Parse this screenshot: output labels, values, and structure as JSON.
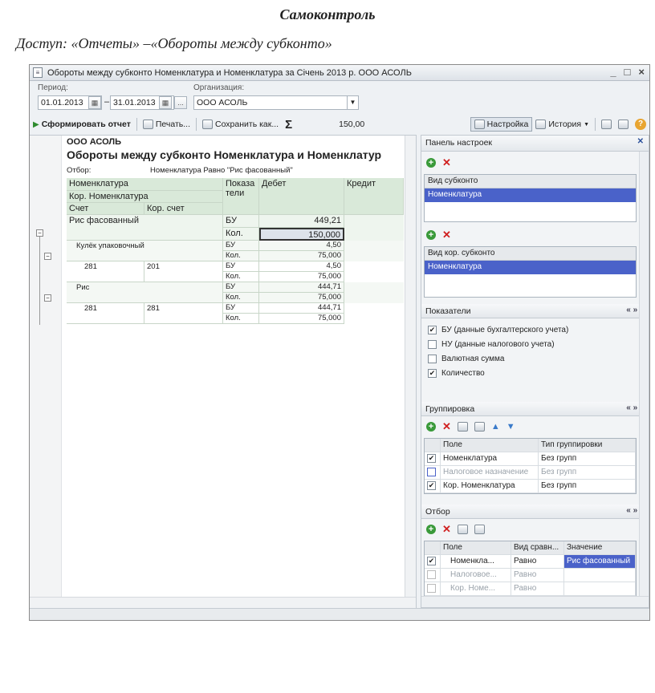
{
  "page": {
    "heading": "Самоконтроль",
    "subheading": "Доступ: «Отчеты» –«Обороты между субконто»"
  },
  "window": {
    "title": "Обороты между субконто Номенклатура и Номенклатура за Січень 2013 р. ООО АСОЛЬ",
    "controls": [
      "_",
      "□",
      "×"
    ]
  },
  "filters": {
    "period_label": "Период:",
    "date_from": "01.01.2013",
    "dash": "–",
    "date_to": "31.01.2013",
    "ellipsis": "...",
    "org_label": "Организация:",
    "org_value": "ООО АСОЛЬ"
  },
  "toolbar": {
    "generate": "Сформировать отчет",
    "print": "Печать...",
    "save": "Сохранить как...",
    "sigma": "Σ",
    "sum": "150,00",
    "settings": "Настройка",
    "history": "История",
    "help": "?"
  },
  "report": {
    "org": "ООО АСОЛЬ",
    "title": "Обороты между субконто Номенклатура и Номенклатур",
    "filter_label": "Отбор:",
    "filter_text": "Номенклатура Равно \"Рис фасованный\"",
    "headers": {
      "nom": "Номенклатура",
      "pokaz": "Показа тели",
      "debet": "Дебет",
      "kredit": "Кредит",
      "kor_nom": "Кор. Номенклатура",
      "schet": "Счет",
      "kor_schet": "Кор. счет"
    },
    "rows": [
      {
        "name": "Рис фасованный",
        "bu": "БУ",
        "bu_val": "449,21",
        "kol": "Кол.",
        "kol_val": "150,000"
      },
      {
        "name": "Кулёк упаковочный",
        "bu": "БУ",
        "bu_val": "4,50",
        "kol": "Кол.",
        "kol_val": "75,000"
      },
      {
        "schet": "281",
        "kor": "201",
        "bu": "БУ",
        "bu_val": "4,50",
        "kol": "Кол.",
        "kol_val": "75,000"
      },
      {
        "name": "Рис",
        "bu": "БУ",
        "bu_val": "444,71",
        "kol": "Кол.",
        "kol_val": "75,000"
      },
      {
        "schet": "281",
        "kor": "281",
        "bu": "БУ",
        "bu_val": "444,71",
        "kol": "Кол.",
        "kol_val": "75,000"
      }
    ]
  },
  "panel": {
    "title": "Панель настроек",
    "vid_subkonto": "Вид субконто",
    "vid_subkonto_sel": "Номенклатура",
    "vid_kor": "Вид кор. субконто",
    "vid_kor_sel": "Номенклатура",
    "pokazateli": "Показатели",
    "checks": [
      {
        "label": "БУ (данные бухгалтерского учета)",
        "checked": "✔"
      },
      {
        "label": "НУ (данные налогового учета)",
        "checked": ""
      },
      {
        "label": "Валютная сумма",
        "checked": ""
      },
      {
        "label": "Количество",
        "checked": "✔"
      }
    ],
    "gruppirovka": "Группировка",
    "gr_headers": {
      "pole": "Поле",
      "tip": "Тип группировки"
    },
    "gr_rows": [
      {
        "chk": "✔",
        "pole": "Номенклатура",
        "tip": "Без групп"
      },
      {
        "chk": "",
        "pole": "Налоговое назначение",
        "tip": "Без групп"
      },
      {
        "chk": "✔",
        "pole": "Кор. Номенклатура",
        "tip": "Без групп"
      }
    ],
    "otbor": "Отбор",
    "ot_headers": {
      "pole": "Поле",
      "vid": "Вид сравн...",
      "znach": "Значение"
    },
    "ot_rows": [
      {
        "chk": "✔",
        "pole": "Номенкла...",
        "vid": "Равно",
        "znach": "Рис фасованный"
      },
      {
        "chk": "",
        "pole": "Налоговое...",
        "vid": "Равно",
        "znach": ""
      },
      {
        "chk": "",
        "pole": "Кор. Номе...",
        "vid": "Равно",
        "znach": ""
      }
    ],
    "nav": "« » ▾"
  }
}
